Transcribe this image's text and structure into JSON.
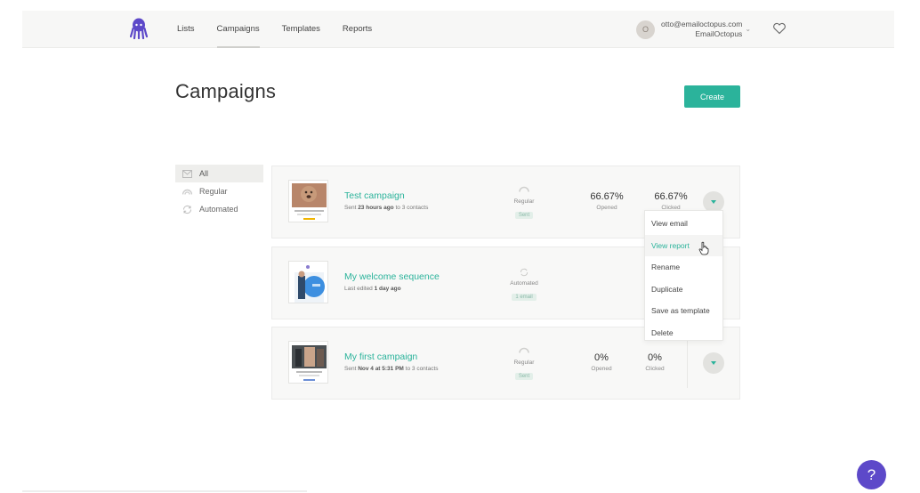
{
  "nav": {
    "items": [
      {
        "label": "Lists",
        "active": false
      },
      {
        "label": "Campaigns",
        "active": true
      },
      {
        "label": "Templates",
        "active": false
      },
      {
        "label": "Reports",
        "active": false
      }
    ]
  },
  "account": {
    "avatar_letter": "O",
    "email": "otto@emailoctopus.com",
    "org": "EmailOctopus"
  },
  "page": {
    "title": "Campaigns",
    "create_label": "Create"
  },
  "filters": [
    {
      "label": "All",
      "icon": "envelope-icon",
      "active": true
    },
    {
      "label": "Regular",
      "icon": "rainbow-icon",
      "active": false
    },
    {
      "label": "Automated",
      "icon": "refresh-icon",
      "active": false
    }
  ],
  "campaigns": [
    {
      "name": "Test campaign",
      "sub_prefix": "Sent ",
      "sub_bold": "23 hours ago",
      "sub_suffix": " to 3 contacts",
      "type": "Regular",
      "badge": "Sent",
      "opened_value": "66.67%",
      "opened_label": "Opened",
      "clicked_value": "66.67%",
      "clicked_label": "Clicked"
    },
    {
      "name": "My welcome sequence",
      "sub_prefix": "Last edited ",
      "sub_bold": "1 day ago",
      "sub_suffix": "",
      "type": "Automated",
      "badge": "1 email"
    },
    {
      "name": "My first campaign",
      "sub_prefix": "Sent ",
      "sub_bold": "Nov 4 at 5:31 PM",
      "sub_suffix": " to 3 contacts",
      "type": "Regular",
      "badge": "Sent",
      "opened_value": "0%",
      "opened_label": "Opened",
      "clicked_value": "0%",
      "clicked_label": "Clicked"
    }
  ],
  "menu": {
    "items": [
      "View email",
      "View report",
      "Rename",
      "Duplicate",
      "Save as template",
      "Delete"
    ],
    "hovered": "View report"
  },
  "help_label": "?",
  "colors": {
    "accent": "#2bb39b",
    "help": "#5d49c9",
    "logo": "#5d49c9"
  }
}
